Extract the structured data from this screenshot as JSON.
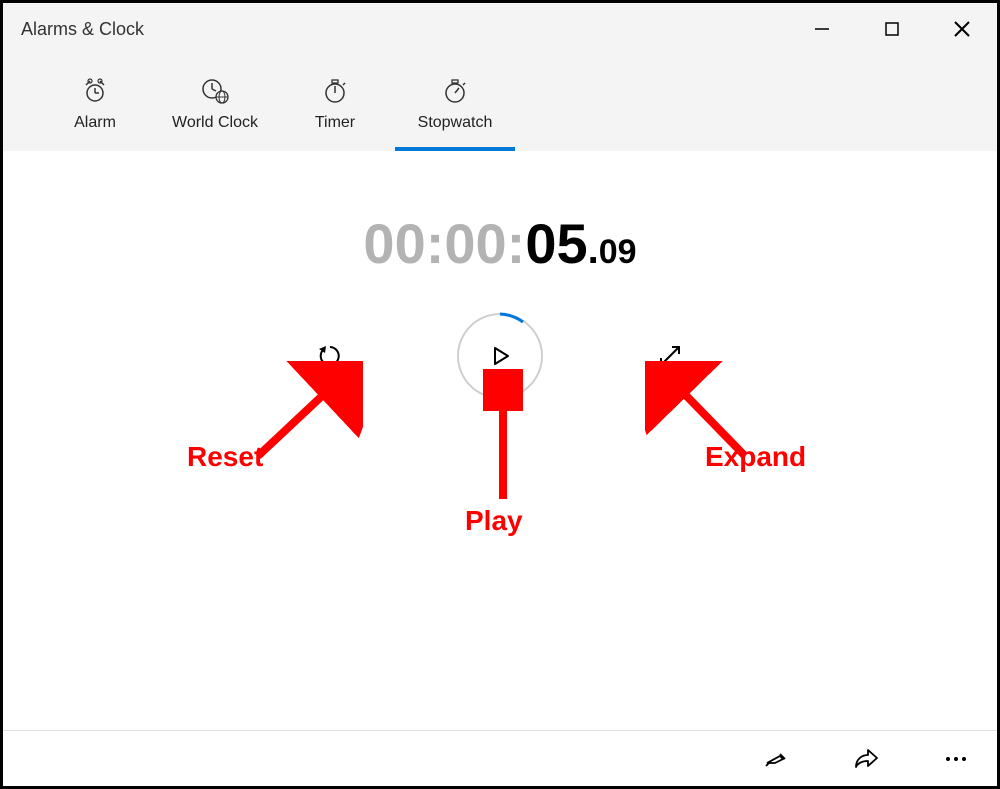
{
  "window": {
    "title": "Alarms & Clock"
  },
  "tabs": {
    "alarm": "Alarm",
    "world_clock": "World Clock",
    "timer": "Timer",
    "stopwatch": "Stopwatch",
    "active": "stopwatch"
  },
  "stopwatch": {
    "hours": "00",
    "minutes": "00",
    "seconds": "05",
    "centiseconds": "09",
    "separator": ":",
    "dot": "."
  },
  "controls": {
    "reset": "Reset",
    "play": "Play",
    "expand": "Expand"
  },
  "annotations": {
    "reset": "Reset",
    "play": "Play",
    "expand": "Expand"
  },
  "bottom_bar": {
    "pin": "Pin",
    "share": "Share",
    "more": "More"
  }
}
